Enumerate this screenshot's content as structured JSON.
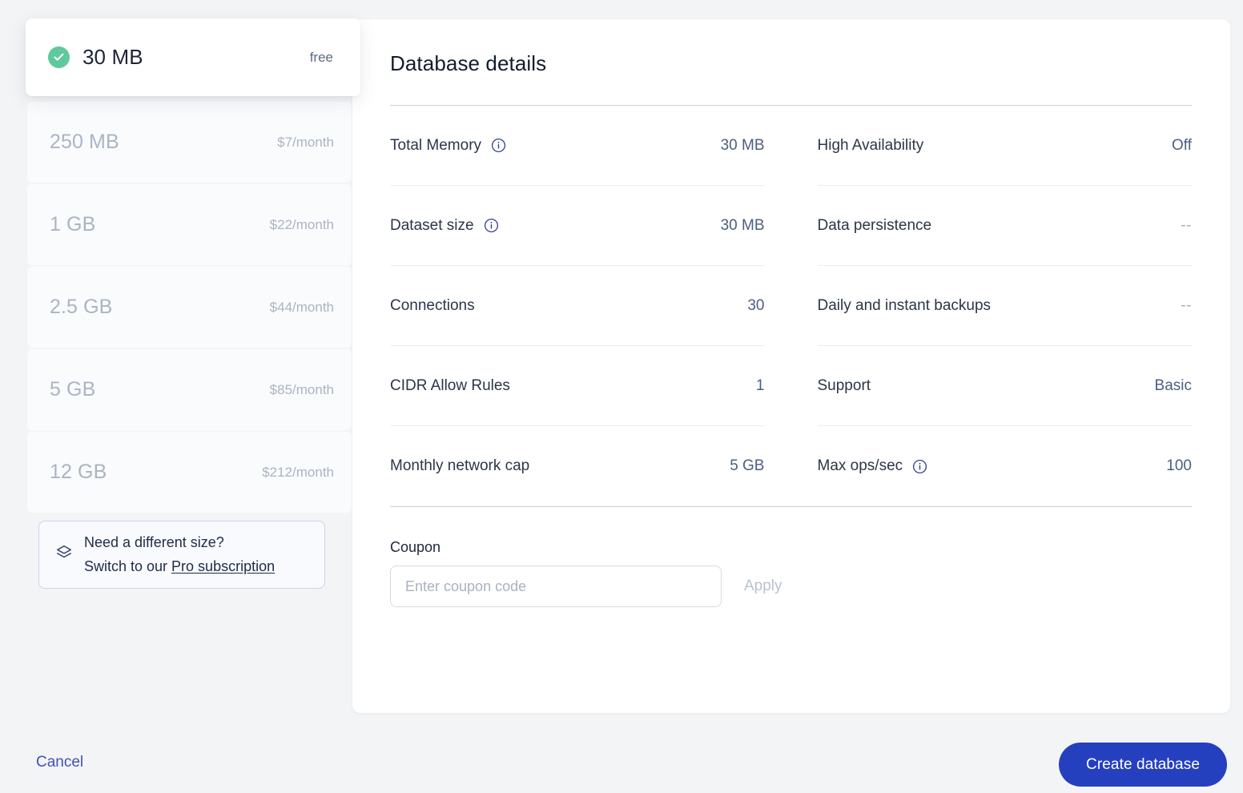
{
  "plans": {
    "items": [
      {
        "name": "30 MB",
        "price": "free",
        "selected": true,
        "icon": "check-circle-icon"
      },
      {
        "name": "250 MB",
        "price": "$7/month",
        "selected": false
      },
      {
        "name": "1 GB",
        "price": "$22/month",
        "selected": false
      },
      {
        "name": "2.5 GB",
        "price": "$44/month",
        "selected": false
      },
      {
        "name": "5 GB",
        "price": "$85/month",
        "selected": false
      },
      {
        "name": "12 GB",
        "price": "$212/month",
        "selected": false
      }
    ]
  },
  "pro_callout": {
    "icon": "layers-icon",
    "line1": "Need a different size?",
    "line2_prefix": "Switch to our ",
    "link_label": "Pro subscription"
  },
  "details": {
    "title": "Database details",
    "specs_left": [
      {
        "label": "Total Memory",
        "value": "30 MB",
        "info": true
      },
      {
        "label": "Dataset size",
        "value": "30 MB",
        "info": true
      },
      {
        "label": "Connections",
        "value": "30",
        "info": false
      },
      {
        "label": "CIDR Allow Rules",
        "value": "1",
        "info": false
      },
      {
        "label": "Monthly network cap",
        "value": "5 GB",
        "info": false
      }
    ],
    "specs_right": [
      {
        "label": "High Availability",
        "value": "Off",
        "info": false,
        "muted": false
      },
      {
        "label": "Data persistence",
        "value": "--",
        "info": false,
        "muted": true
      },
      {
        "label": "Daily and instant backups",
        "value": "--",
        "info": false,
        "muted": true
      },
      {
        "label": "Support",
        "value": "Basic",
        "info": false,
        "muted": false
      },
      {
        "label": "Max ops/sec",
        "value": "100",
        "info": true,
        "muted": false
      }
    ]
  },
  "coupon": {
    "label": "Coupon",
    "placeholder": "Enter coupon code",
    "value": "",
    "apply_label": "Apply"
  },
  "footer": {
    "cancel_label": "Cancel",
    "create_label": "Create database"
  },
  "colors": {
    "accent": "#2540bf",
    "link": "#3f51b7",
    "success": "#5ec99a",
    "page_bg": "#f3f4f6",
    "value_text": "#4b5f80"
  }
}
